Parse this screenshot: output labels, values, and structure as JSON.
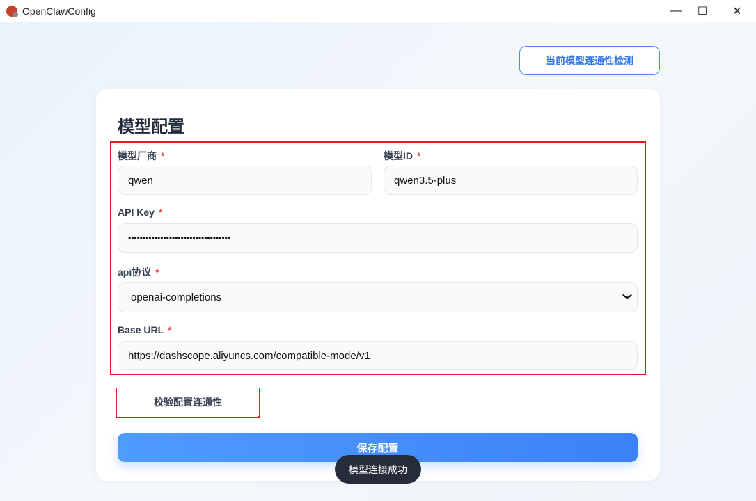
{
  "window": {
    "title": "OpenClawConfig",
    "minimize": "—",
    "maximize": "☐",
    "close": "✕"
  },
  "header": {
    "check_button": "当前模型连通性检测"
  },
  "form": {
    "title": "模型配置",
    "required_mark": "*",
    "vendor": {
      "label": "模型厂商",
      "value": "qwen"
    },
    "model_id": {
      "label": "模型ID",
      "value": "qwen3.5-plus"
    },
    "api_key": {
      "label": "API Key",
      "value": "•••••••••••••••••••••••••••••••••••"
    },
    "api_protocol": {
      "label": "api协议",
      "value": "openai-completions"
    },
    "base_url": {
      "label": "Base URL",
      "value": "https://dashscope.aliyuncs.com/compatible-mode/v1"
    },
    "verify_button": "校验配置连通性",
    "save_button": "保存配置"
  },
  "toast": "模型连接成功"
}
